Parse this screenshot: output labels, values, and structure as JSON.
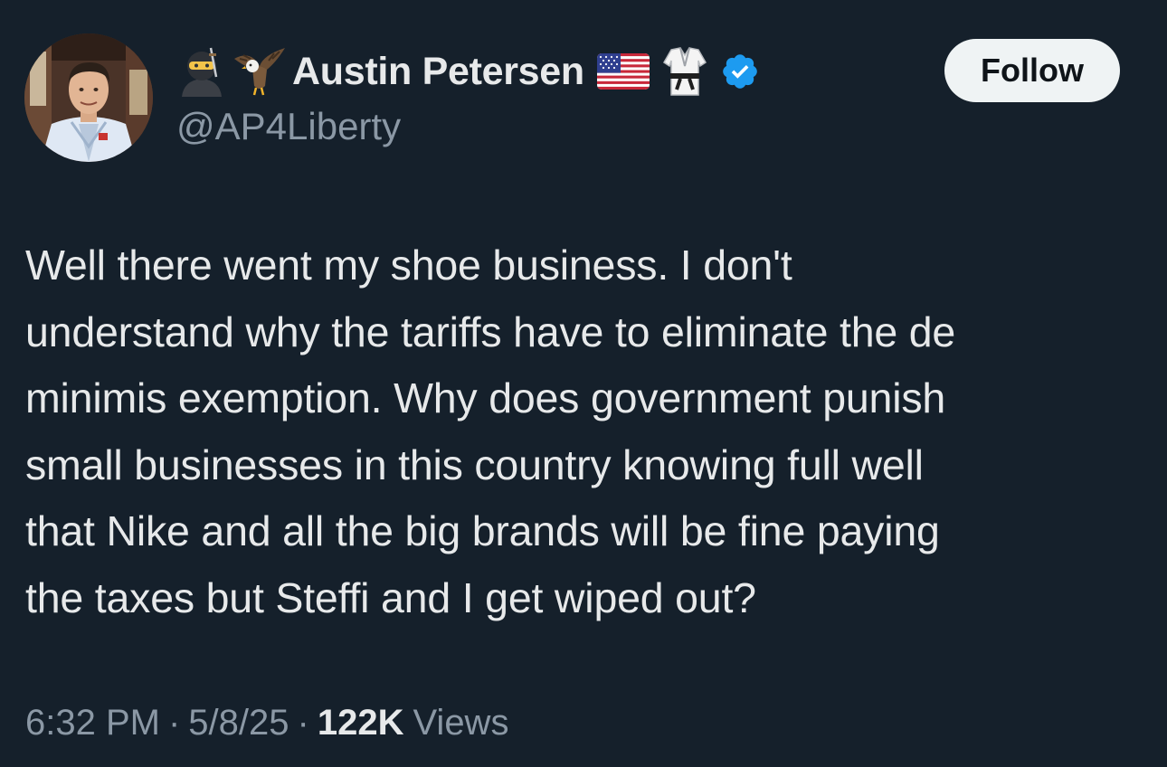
{
  "author": {
    "display_name": "Austin Petersen",
    "handle": "@AP4Liberty",
    "name_prefix_icons": [
      "ninja-icon",
      "eagle-icon"
    ],
    "name_suffix_icons": [
      "us-flag-icon",
      "martial-arts-uniform-icon",
      "verified-badge-icon"
    ],
    "verified_color": "#1d9bf0"
  },
  "actions": {
    "follow_label": "Follow"
  },
  "tweet": {
    "lines": [
      "Well there went my shoe business. I don't",
      "understand why the tariffs have to eliminate the de",
      "minimis exemption. Why does government punish",
      "small businesses in this country knowing full well",
      "that Nike and all the big brands will be fine paying",
      "the taxes but Steffi and I get wiped out?"
    ]
  },
  "meta": {
    "time": "6:32 PM",
    "separator": "·",
    "date": "5/8/25",
    "views_count": "122K",
    "views_label": "Views"
  },
  "colors": {
    "background": "#15202b",
    "primary_text": "#e7e9ea",
    "secondary_text": "#8b98a5",
    "follow_button_bg": "#eff3f4",
    "follow_button_text": "#0f1419"
  }
}
